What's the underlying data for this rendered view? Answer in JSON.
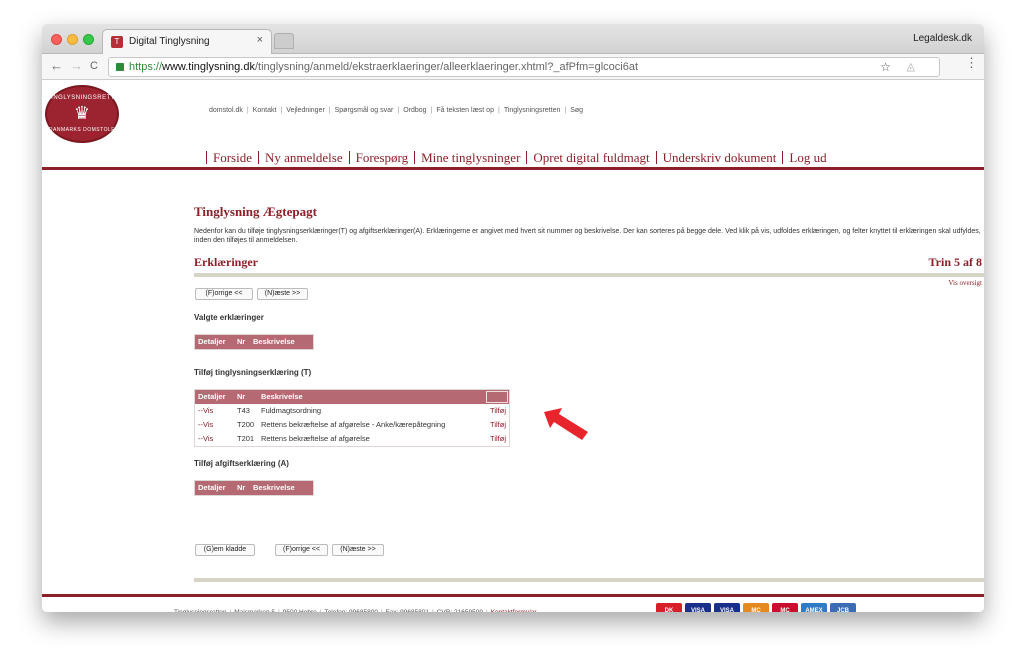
{
  "browser": {
    "tab_title": "Digital Tinglysning",
    "tab_close": "×",
    "profile_name": "Legaldesk.dk",
    "url_scheme": "https://",
    "url_host": "www.tinglysning.dk",
    "url_path": "/tinglysning/anmeld/ekstraerklaeringer/alleerklaeringer.xhtml?_afPfm=glcoci6at",
    "back_glyph": "←",
    "forward_glyph": "→",
    "reload_glyph": "C",
    "star_glyph": "☆",
    "ext_glyph": "◬",
    "menu_glyph": "⋮",
    "favicon_glyph": "T"
  },
  "logo": {
    "top_text": "TINGLYSNINGSRETTEN",
    "bottom_text": "DANMARKS DOMSTOLE",
    "crown_glyph": "♛"
  },
  "util_links": [
    "domstol.dk",
    "Kontakt",
    "Vejledninger",
    "Spørgsmål og svar",
    "Ordbog",
    "Få teksten læst op",
    "Tinglysningsretten",
    "Søg"
  ],
  "main_nav": [
    "Forside",
    "Ny anmeldelse",
    "Forespørg",
    "Mine tinglysninger",
    "Opret digital fuldmagt",
    "Underskriv dokument",
    "Log ud"
  ],
  "page": {
    "title": "Tinglysning Ægtepagt",
    "intro": "Nedenfor kan du tilføje tinglysningserklæringer(T) og afgiftserklæringer(A). Erklæringerne er angivet med hvert sit nummer og beskrivelse. Der kan sorteres på begge dele. Ved klik på vis, udfoldes erklæringen, og felter knyttet til erklæringen skal udfyldes, inden den tilføjes til anmeldelsen.",
    "section_title": "Erklæringer",
    "step": "Trin 5 af 8",
    "vis_oversigt": "Vis oversigt",
    "prev_button": "(F)orrige <<",
    "next_button": "(N)æste >>",
    "save_draft_button": "(G)em kladde"
  },
  "valgte": {
    "heading": "Valgte erklæringer",
    "columns": [
      "Detaljer",
      "Nr",
      "Beskrivelse"
    ]
  },
  "tinglysning": {
    "heading": "Tilføj tinglysningserklæring (T)",
    "columns": [
      "Detaljer",
      "Nr",
      "Beskrivelse"
    ],
    "rows": [
      {
        "vis": "--Vis",
        "nr": "T43",
        "beskrivelse": "Fuldmagtsordning",
        "action": "Tilføj"
      },
      {
        "vis": "--Vis",
        "nr": "T200",
        "beskrivelse": "Rettens bekræftelse af afgørelse - Anke/kærepåtegning",
        "action": "Tilføj"
      },
      {
        "vis": "--Vis",
        "nr": "T201",
        "beskrivelse": "Rettens bekræftelse af afgørelse",
        "action": "Tilføj"
      }
    ]
  },
  "afgift": {
    "heading": "Tilføj afgiftserklæring (A)",
    "columns": [
      "Detaljer",
      "Nr",
      "Beskrivelse"
    ]
  },
  "footer": {
    "items": [
      "Tinglysningsretten",
      "Majsmarken 5",
      "9500 Hobro",
      "Telefon: 99685800",
      "Fax: 99685801",
      "CVR: 21659509"
    ],
    "contact": "Kontaktformular",
    "cards": [
      {
        "label": "DK",
        "color": "#d81e28"
      },
      {
        "label": "VISA",
        "color": "#1a2f8a"
      },
      {
        "label": "VISA",
        "color": "#1a2f8a"
      },
      {
        "label": "MC",
        "color": "#e58a1f"
      },
      {
        "label": "MC",
        "color": "#c8102e"
      },
      {
        "label": "AMEX",
        "color": "#2f7bc4"
      },
      {
        "label": "JCB",
        "color": "#3a6db3"
      }
    ]
  },
  "colors": {
    "brand": "#8c1f28",
    "table_header": "#b56a73",
    "arrow": "#e8242c"
  }
}
